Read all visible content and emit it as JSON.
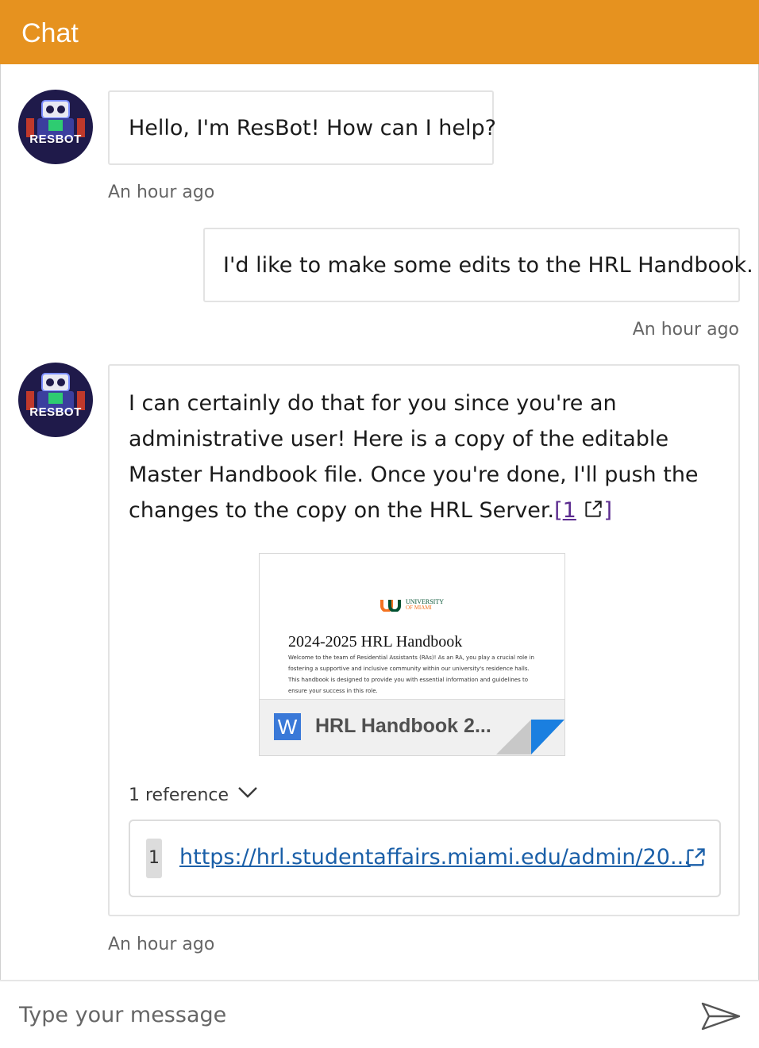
{
  "header": {
    "title": "Chat"
  },
  "bot": {
    "avatar_text": "RESBOT"
  },
  "messages": [
    {
      "sender": "bot",
      "text": "Hello, I'm ResBot! How can I help?",
      "timestamp": "An hour ago"
    },
    {
      "sender": "user",
      "text": "I'd like to make some edits to the HRL Handbook.",
      "timestamp": "An hour ago"
    },
    {
      "sender": "bot",
      "text": "I can certainly do that for you since you're an administrative user! Here is a copy of the editable Master Handbook file. Once you're done, I'll push the changes to the copy on the HRL Server.",
      "citation_open": "[",
      "citation_num": "1",
      "citation_close": "]",
      "attachment": {
        "preview_logo_line1": "UNIVERSITY",
        "preview_logo_line2": "OF MIAMI",
        "preview_title": "2024-2025 HRL Handbook",
        "preview_body": "Welcome to the team of Residential Assistants (RAs)! As an RA, you play a crucial role in fostering a supportive and inclusive community within our university's residence halls. This handbook is designed to provide you with essential information and guidelines to ensure your success in this role.",
        "name": "HRL Handbook 2...",
        "file_icon_letter": "W"
      },
      "references_label": "1 reference",
      "references": [
        {
          "num": "1",
          "url": "https://hrl.studentaffairs.miami.edu/admin/20..."
        }
      ],
      "timestamp": "An hour ago"
    }
  ],
  "composer": {
    "placeholder": "Type your message"
  },
  "colors": {
    "header": "#e6921f",
    "avatar_bg": "#1f1a4a",
    "link": "#1a5fa8",
    "citation": "#5b2b8f",
    "word_blue": "#3a79d8"
  }
}
